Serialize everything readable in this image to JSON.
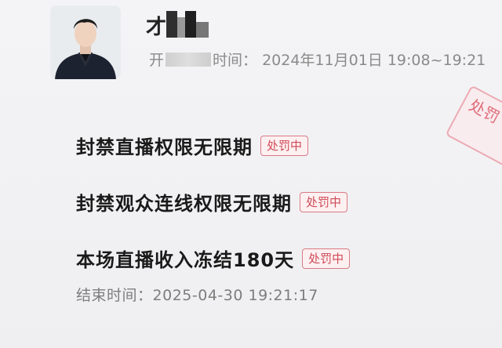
{
  "header": {
    "name_visible": "才",
    "start_time_label_prefix": "开",
    "start_time_label_suffix": "时间：",
    "start_time_value": "2024年11月01日 19:08~19:21"
  },
  "stamp_text": "处罚",
  "penalties": [
    {
      "title": "封禁直播权限无限期",
      "status": "处罚中"
    },
    {
      "title": "封禁观众连线权限无限期",
      "status": "处罚中"
    },
    {
      "title": "本场直播收入冻结180天",
      "status": "处罚中"
    }
  ],
  "end": {
    "label": "结束时间：",
    "value": "2025-04-30 19:21:17"
  },
  "colors": {
    "badge_text": "#d04a57",
    "badge_border": "#d97b85",
    "title_text": "#1a1a1a",
    "meta_text": "#8a8a8a"
  }
}
